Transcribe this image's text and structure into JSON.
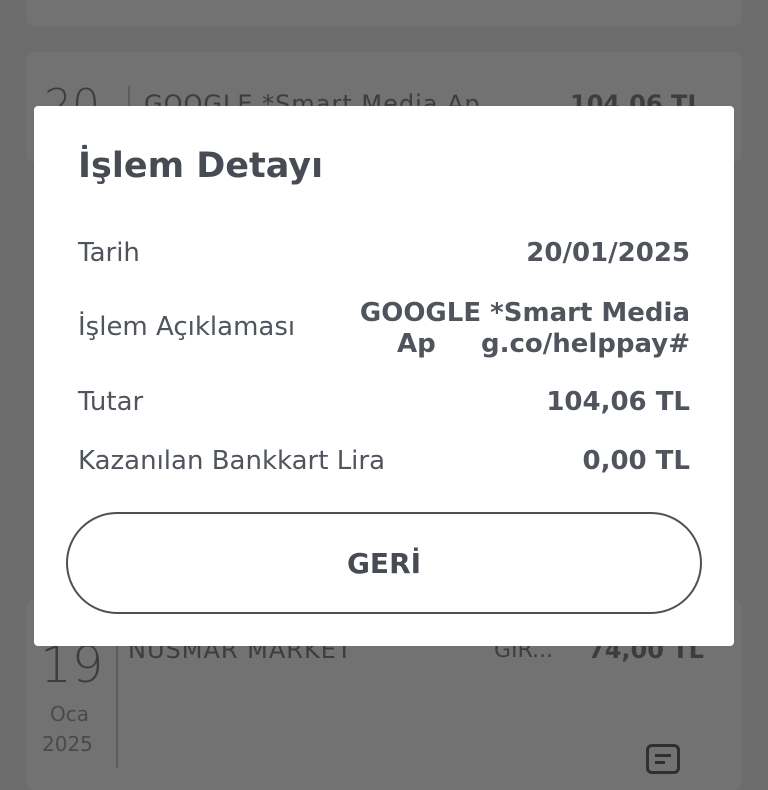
{
  "background": {
    "items": [
      {
        "day": "20",
        "merchant": "GOOGLE *Smart Media Ap",
        "amount": "104,06 TL"
      },
      {
        "day": "19",
        "month": "Oca",
        "year": "2025",
        "merchant": "NUSMAR MARKET",
        "type": "GIR...",
        "amount": "74,00 TL"
      }
    ]
  },
  "modal": {
    "title": "İşlem Detayı",
    "rows": [
      {
        "label": "Tarih",
        "value": "20/01/2025"
      },
      {
        "label": "İşlem Açıklaması",
        "value_line1": "GOOGLE *Smart Media",
        "value_line2": "Ap     g.co/helppay#"
      },
      {
        "label": "Tutar",
        "value": "104,06 TL"
      },
      {
        "label": "Kazanılan Bankkart Lira",
        "value": "0,00 TL"
      }
    ],
    "back_label": "GERİ"
  }
}
